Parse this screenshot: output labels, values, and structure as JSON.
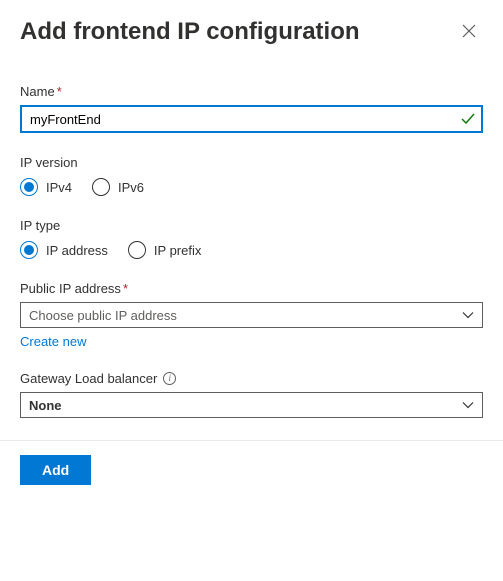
{
  "header": {
    "title": "Add frontend IP configuration"
  },
  "fields": {
    "name": {
      "label": "Name",
      "required_mark": "*",
      "value": "myFrontEnd"
    },
    "ip_version": {
      "label": "IP version",
      "options": {
        "ipv4": "IPv4",
        "ipv6": "IPv6"
      },
      "selected": "ipv4"
    },
    "ip_type": {
      "label": "IP type",
      "options": {
        "ip_address": "IP address",
        "ip_prefix": "IP prefix"
      },
      "selected": "ip_address"
    },
    "public_ip": {
      "label": "Public IP address",
      "required_mark": "*",
      "placeholder": "Choose public IP address",
      "create_new_link": "Create new"
    },
    "gateway_lb": {
      "label": "Gateway Load balancer",
      "value": "None"
    }
  },
  "footer": {
    "add_button": "Add"
  }
}
